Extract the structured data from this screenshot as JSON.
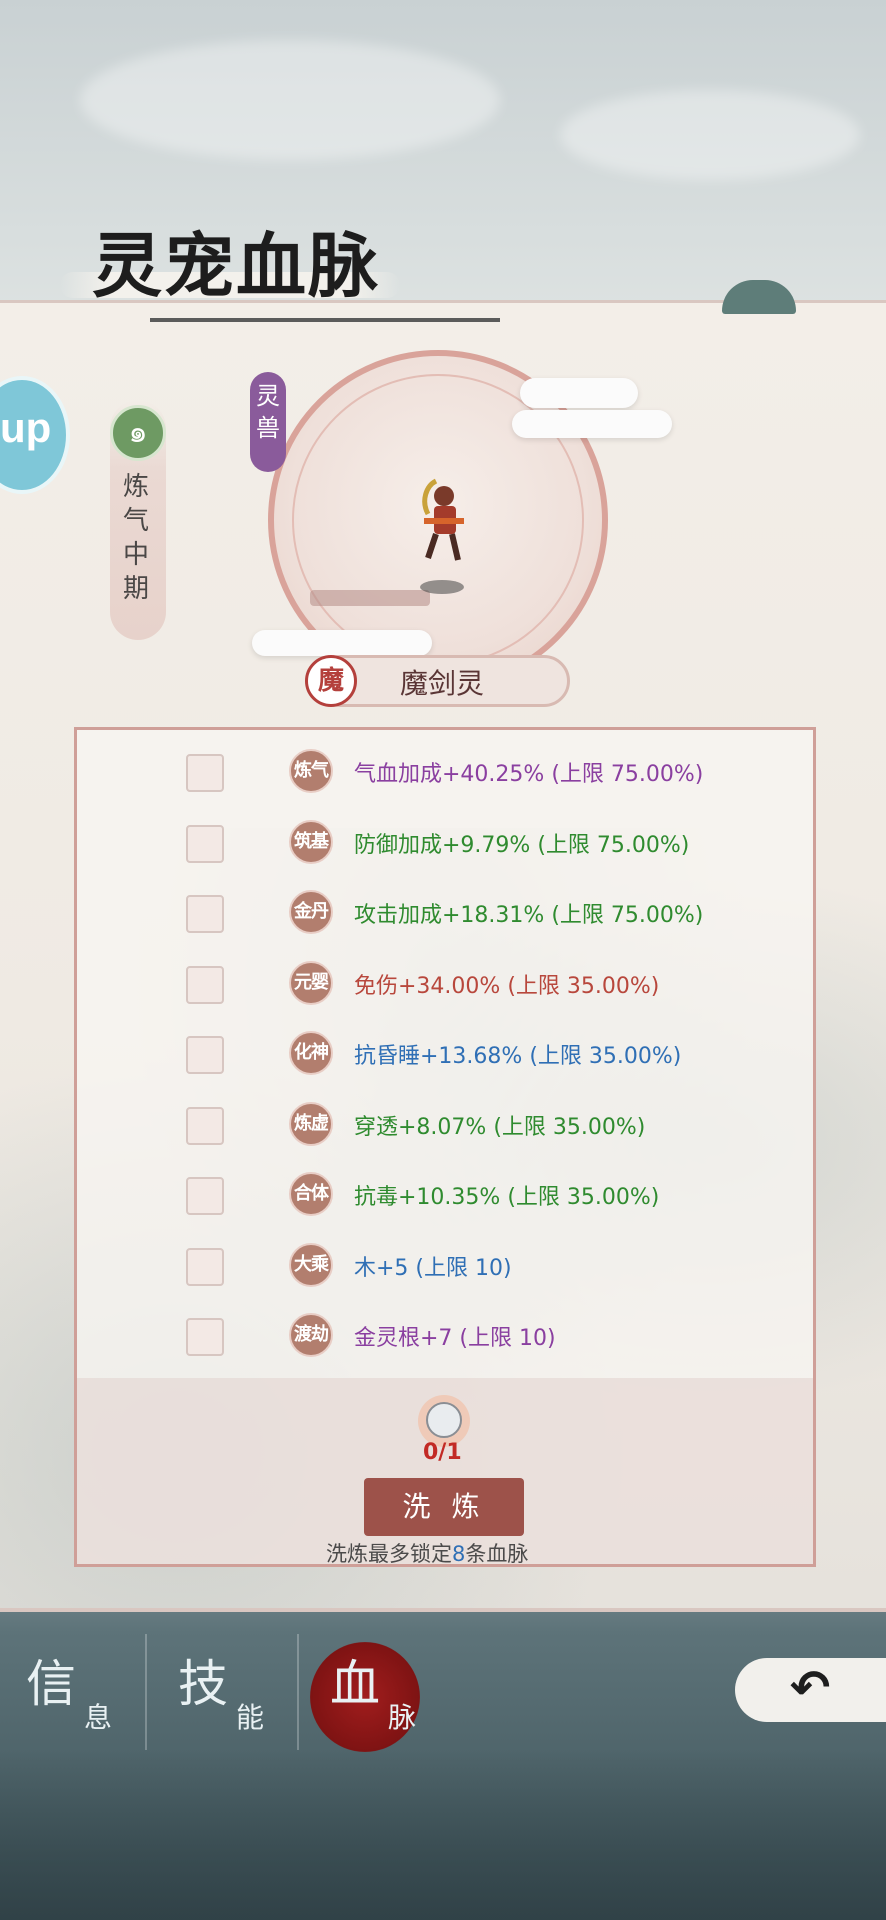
{
  "header": {
    "title": "灵宠血脉"
  },
  "left_button": {
    "label": "up"
  },
  "realm": {
    "label": "炼气中期"
  },
  "pet": {
    "type_tag": "灵兽",
    "name": "魔剑灵",
    "badge": "魔"
  },
  "bloodlines": [
    {
      "stage": "炼气",
      "text": "气血加成+40.25% (上限 75.00%)",
      "color": "purple"
    },
    {
      "stage": "筑基",
      "text": "防御加成+9.79% (上限 75.00%)",
      "color": "green"
    },
    {
      "stage": "金丹",
      "text": "攻击加成+18.31% (上限 75.00%)",
      "color": "green"
    },
    {
      "stage": "元婴",
      "text": "免伤+34.00% (上限 35.00%)",
      "color": "red"
    },
    {
      "stage": "化神",
      "text": "抗昏睡+13.68% (上限 35.00%)",
      "color": "blue"
    },
    {
      "stage": "炼虚",
      "text": "穿透+8.07% (上限 35.00%)",
      "color": "green"
    },
    {
      "stage": "合体",
      "text": "抗毒+10.35% (上限 35.00%)",
      "color": "green"
    },
    {
      "stage": "大乘",
      "text": "木+5 (上限 10)",
      "color": "blue"
    },
    {
      "stage": "渡劫",
      "text": "金灵根+7 (上限 10)",
      "color": "purple"
    }
  ],
  "refine": {
    "item_count": "0/1",
    "button_label": "洗 炼",
    "hint_prefix": "洗炼最多锁定",
    "hint_number": "8",
    "hint_suffix": "条血脉"
  },
  "tabs": [
    {
      "big": "信",
      "small": "息",
      "active": false
    },
    {
      "big": "技",
      "small": "能",
      "active": false
    },
    {
      "big": "血",
      "small": "脉",
      "active": true
    }
  ],
  "colors": {
    "purple": "#8a3fa0",
    "green": "#2f8b2f",
    "red": "#b8473c",
    "blue": "#2f6fb5",
    "accent": "#9d524a"
  }
}
